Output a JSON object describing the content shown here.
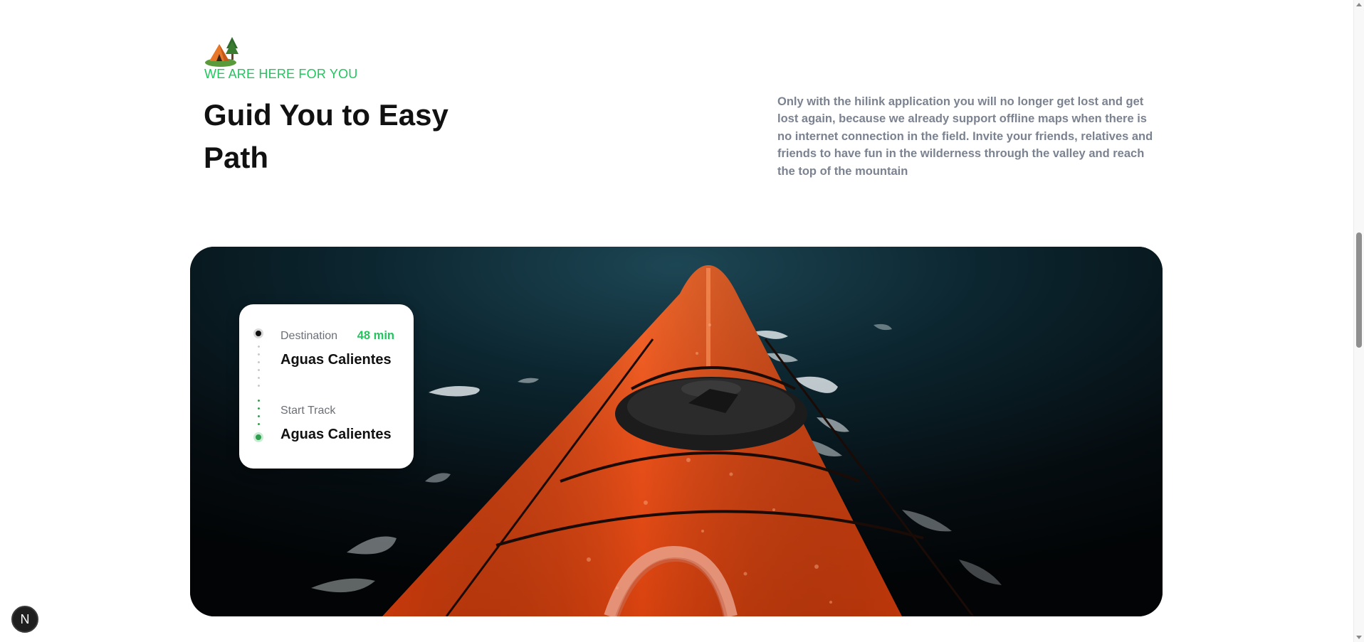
{
  "section": {
    "icon": "camping-tent-icon",
    "eyebrow": "WE ARE HERE FOR YOU",
    "title": "Guid You to Easy Path",
    "description": "Only with the hilink application you will no longer get lost and get lost again, because we already support offline maps when there is no internet connection in the field. Invite your friends, relatives and friends to have fun in the wilderness through the valley and reach the top of the mountain"
  },
  "hero": {
    "image": "orange-kayak-on-dark-water"
  },
  "route_card": {
    "destination_label": "Destination",
    "destination_time": "48 min",
    "destination_place": "Aguas Calientes",
    "start_label": "Start Track",
    "start_place": "Aguas Calientes"
  },
  "badge": {
    "letter": "N"
  },
  "colors": {
    "accent": "#22c55e",
    "text": "#111111",
    "muted": "#7b8290"
  }
}
